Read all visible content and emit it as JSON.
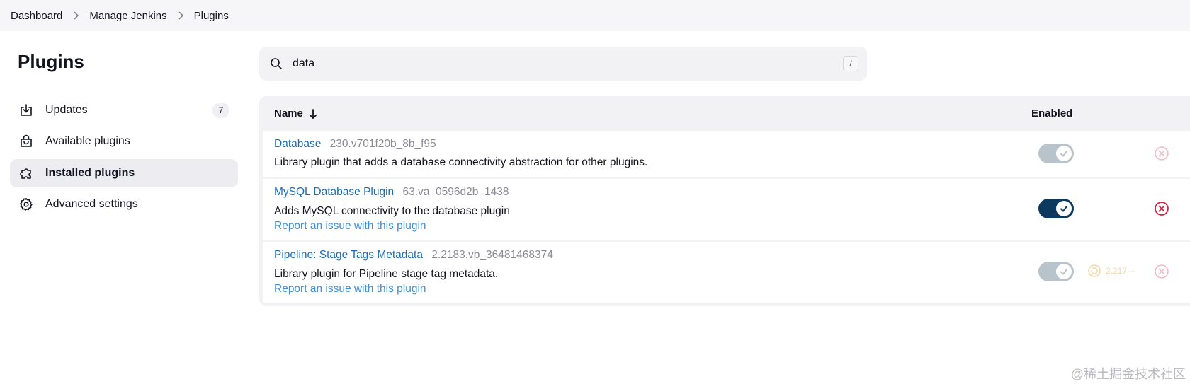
{
  "breadcrumb": [
    "Dashboard",
    "Manage Jenkins",
    "Plugins"
  ],
  "sidebar": {
    "title": "Plugins",
    "items": [
      {
        "label": "Updates",
        "icon": "download-icon",
        "badge": "7"
      },
      {
        "label": "Available plugins",
        "icon": "shopping-bag-icon"
      },
      {
        "label": "Installed plugins",
        "icon": "puzzle-icon",
        "active": true
      },
      {
        "label": "Advanced settings",
        "icon": "gear-icon"
      }
    ]
  },
  "search": {
    "value": "data",
    "shortcut": "/"
  },
  "table": {
    "col_name": "Name",
    "col_enabled": "Enabled",
    "rows": [
      {
        "name": "Database",
        "version": "230.v701f20b_8b_f95",
        "description": "Library plugin that adds a database connectivity abstraction for other plugins.",
        "enabled": true,
        "toggle_state": "disabled"
      },
      {
        "name": "MySQL Database Plugin",
        "version": "63.va_0596d2b_1438",
        "description": "Adds MySQL connectivity to the database plugin",
        "report": "Report an issue with this plugin",
        "enabled": true,
        "toggle_state": "on"
      },
      {
        "name": "Pipeline: Stage Tags Metadata",
        "version": "2.2183.vb_36481468374",
        "description": "Library plugin for Pipeline stage tag metadata.",
        "report": "Report an issue with this plugin",
        "enabled": true,
        "toggle_state": "disabled",
        "faded_version": "2.217···"
      }
    ]
  },
  "colors": {
    "link": "#1b6cb5",
    "toggle_on": "#0b3a5e",
    "toggle_disabled": "#b9c3cb",
    "danger": "#d0213f"
  },
  "watermark": "@稀土掘金技术社区"
}
